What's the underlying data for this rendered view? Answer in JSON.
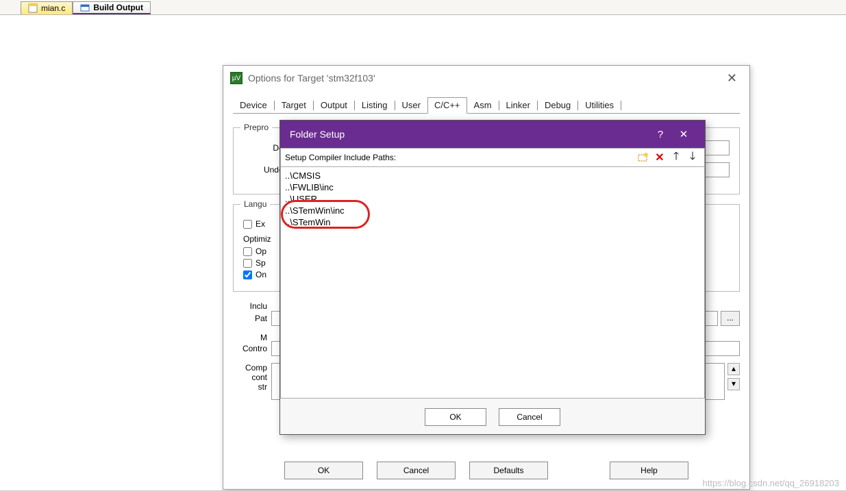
{
  "tabs": {
    "inactive": {
      "label": "mian.c"
    },
    "active": {
      "label": "Build Output"
    }
  },
  "options_dialog": {
    "title": "Options for Target 'stm32f103'",
    "tabs": [
      "Device",
      "Target",
      "Output",
      "Listing",
      "User",
      "C/C++",
      "Asm",
      "Linker",
      "Debug",
      "Utilities"
    ],
    "selected_tab": "C/C++",
    "preprocessor": {
      "title": "Prepro",
      "define_label": "Def",
      "undefine_label": "Undef"
    },
    "language": {
      "title": "Langu",
      "execute_label": "Ex",
      "optimize_label": "Optimiz",
      "op_label": "Op",
      "sp_label": "Sp",
      "on_label": "On",
      "on_checked": true
    },
    "paths": {
      "include_label": "Inclu",
      "path_label": "Pat",
      "m_label": "M",
      "control_label": "Contro",
      "compiler_label": "Comp",
      "cont_label": "cont",
      "str_label": "str"
    },
    "buttons": {
      "ok": "OK",
      "cancel": "Cancel",
      "defaults": "Defaults",
      "help": "Help"
    }
  },
  "folder_dialog": {
    "title": "Folder Setup",
    "toolbar_label": "Setup Compiler Include Paths:",
    "items": [
      "..\\CMSIS",
      "..\\FWLIB\\inc",
      "..\\USER",
      "..\\STemWin\\inc",
      "..\\STemWin"
    ],
    "buttons": {
      "ok": "OK",
      "cancel": "Cancel"
    }
  },
  "watermark": "https://blog.csdn.net/qq_26918203"
}
